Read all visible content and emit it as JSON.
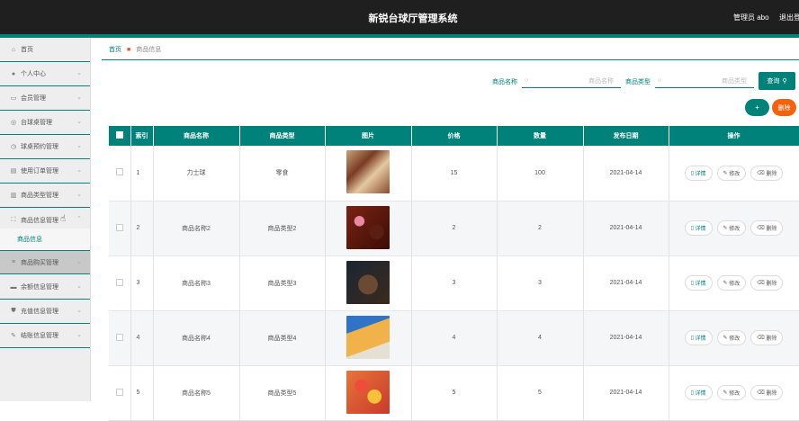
{
  "header": {
    "title": "新锐台球厅管理系统",
    "user": "管理员 abo",
    "logout": "退出登录"
  },
  "sidebar": {
    "items": [
      {
        "label": "首页",
        "icon": "home-icon",
        "glyph": "⌂"
      },
      {
        "label": "个人中心",
        "icon": "user-icon",
        "glyph": "●"
      },
      {
        "label": "会员管理",
        "icon": "message-icon",
        "glyph": "▭"
      },
      {
        "label": "台球桌管理",
        "icon": "target-icon",
        "glyph": "◎"
      },
      {
        "label": "球桌预约管理",
        "icon": "clock-icon",
        "glyph": "◷"
      },
      {
        "label": "使用订单管理",
        "icon": "document-icon",
        "glyph": "▤"
      },
      {
        "label": "商品类型管理",
        "icon": "chart-icon",
        "glyph": "▥"
      },
      {
        "label": "商品信息管理",
        "icon": "expand-icon",
        "glyph": "⛶"
      },
      {
        "label": "商品购买管理",
        "icon": "list-icon",
        "glyph": "≡"
      },
      {
        "label": "余额信息管理",
        "icon": "wallet-icon",
        "glyph": "▬"
      },
      {
        "label": "充值信息管理",
        "icon": "shield-icon",
        "glyph": "⛊"
      },
      {
        "label": "结账信息管理",
        "icon": "edit-icon",
        "glyph": "✎"
      }
    ],
    "submenu": "商品信息"
  },
  "breadcrumb": {
    "home": "首页",
    "current": "商品信息"
  },
  "search": {
    "name_label": "商品名称",
    "name_placeholder": "商品名称",
    "type_label": "商品类型",
    "type_placeholder": "商品类型",
    "query_button": "查询"
  },
  "actions": {
    "add": "+",
    "delete": "删除"
  },
  "table": {
    "headers": [
      "索引",
      "商品名称",
      "商品类型",
      "图片",
      "价格",
      "数量",
      "发布日期",
      "操作"
    ],
    "rows": [
      {
        "index": "1",
        "name": "力士球",
        "type": "零食",
        "price": "15",
        "qty": "100",
        "date": "2021-04-14"
      },
      {
        "index": "2",
        "name": "商品名称2",
        "type": "商品类型2",
        "price": "2",
        "qty": "2",
        "date": "2021-04-14"
      },
      {
        "index": "3",
        "name": "商品名称3",
        "type": "商品类型3",
        "price": "3",
        "qty": "3",
        "date": "2021-04-14"
      },
      {
        "index": "4",
        "name": "商品名称4",
        "type": "商品类型4",
        "price": "4",
        "qty": "4",
        "date": "2021-04-14"
      },
      {
        "index": "5",
        "name": "商品名称5",
        "type": "商品类型5",
        "price": "5",
        "qty": "5",
        "date": "2021-04-14"
      }
    ],
    "op_detail": "详情",
    "op_edit": "修改",
    "op_delete": "删除"
  },
  "colors": {
    "accent": "#00817a",
    "danger": "#f5620e",
    "topbar": "#1f1f1f"
  }
}
